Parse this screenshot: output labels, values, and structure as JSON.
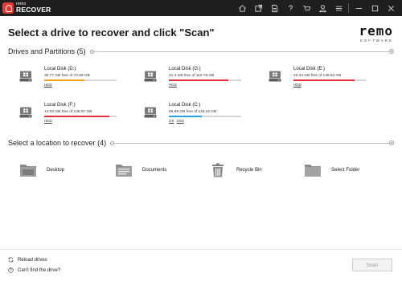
{
  "app": {
    "logo_small": "remo",
    "logo_big": "RECOVER",
    "toolbar_icons": [
      "home-icon",
      "export-icon",
      "document-icon",
      "help-icon",
      "cart-icon",
      "user-icon",
      "menu-icon",
      "minimize-icon",
      "maximize-icon",
      "close-icon"
    ],
    "brand_name": "remo",
    "brand_sub": "SOFTWARE"
  },
  "header": {
    "title": "Select a drive to recover and click \"Scan\""
  },
  "drives_section": {
    "title": "Drives and Partitions",
    "count": "(5)",
    "drives": [
      {
        "name": "Local Disk (D:)",
        "free": "30.77 GB free of 70.59 GB",
        "type": [
          "HDD"
        ],
        "used_fraction": 0.56,
        "bar_color": "#f0a020"
      },
      {
        "name": "Local Disk (G:)",
        "free": "21.4 GB free of 119.78 GB",
        "type": [
          "HDD"
        ],
        "used_fraction": 0.82,
        "bar_color": "#e0303a"
      },
      {
        "name": "Local Disk (E:)",
        "free": "22.34 GB free of 139.52 GB",
        "type": [
          "HDD"
        ],
        "used_fraction": 0.84,
        "bar_color": "#e0303a"
      },
      {
        "name": "Local Disk (F:)",
        "free": "14.03 GB free of 135.87 GB",
        "type": [
          "HDD"
        ],
        "used_fraction": 0.9,
        "bar_color": "#e0303a"
      },
      {
        "name": "Local Disk (C:)",
        "free": "65.89 GB free of 119.24 GB",
        "type": [
          "OS",
          "SSD"
        ],
        "used_fraction": 0.45,
        "bar_color": "#2aa3e0"
      }
    ]
  },
  "locations_section": {
    "title": "Select a location to recover",
    "count": "(4)",
    "locations": [
      {
        "label": "Desktop",
        "icon": "desktop-folder-icon"
      },
      {
        "label": "Documents",
        "icon": "documents-folder-icon"
      },
      {
        "label": "Recycle Bin",
        "icon": "recycle-bin-icon"
      },
      {
        "label": "Select Folder",
        "icon": "folder-icon"
      }
    ]
  },
  "footer": {
    "reload_label": "Reload drives",
    "help_label": "Can't find the drive?",
    "scan_label": "Scan"
  }
}
